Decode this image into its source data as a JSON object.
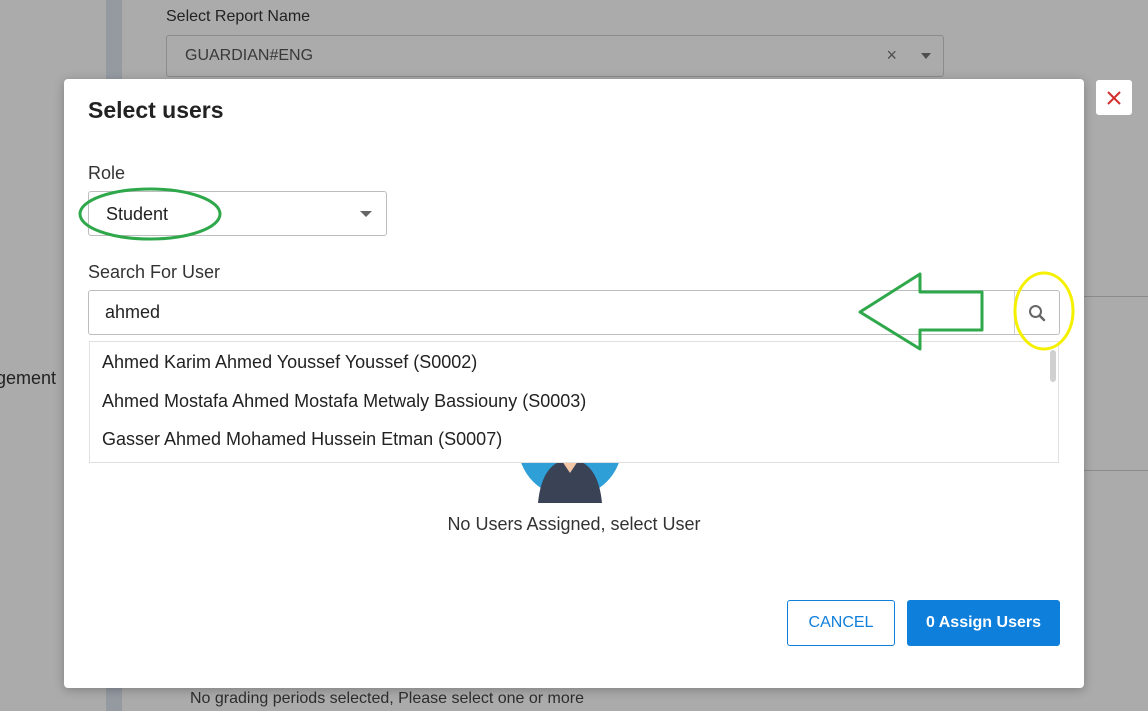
{
  "background": {
    "report_label": "Select Report Name",
    "report_value": "GUARDIAN#ENG",
    "report_clear": "×",
    "side_text": "gement",
    "bottom_text": "No grading periods selected, Please select one or more"
  },
  "modal": {
    "title": "Select users",
    "role_label": "Role",
    "role_value": "Student",
    "search_label": "Search For User",
    "search_value": "ahmed",
    "results": [
      "Ahmed Karim Ahmed Youssef Youssef (S0002)",
      "Ahmed Mostafa Ahmed Mostafa Metwaly Bassiouny (S0003)",
      "Gasser Ahmed Mohamed Hussein Etman (S0007)"
    ],
    "empty_text": "No Users Assigned, select User",
    "cancel_label": "CANCEL",
    "assign_label": "0 Assign Users"
  },
  "icons": {
    "search": "search-icon",
    "close": "close-icon",
    "caret": "chevron-down-icon"
  },
  "colors": {
    "primary": "#0f7fdc",
    "close": "#d32f2f",
    "annotation_green": "#2ea84a",
    "annotation_yellow": "#f5f000"
  }
}
